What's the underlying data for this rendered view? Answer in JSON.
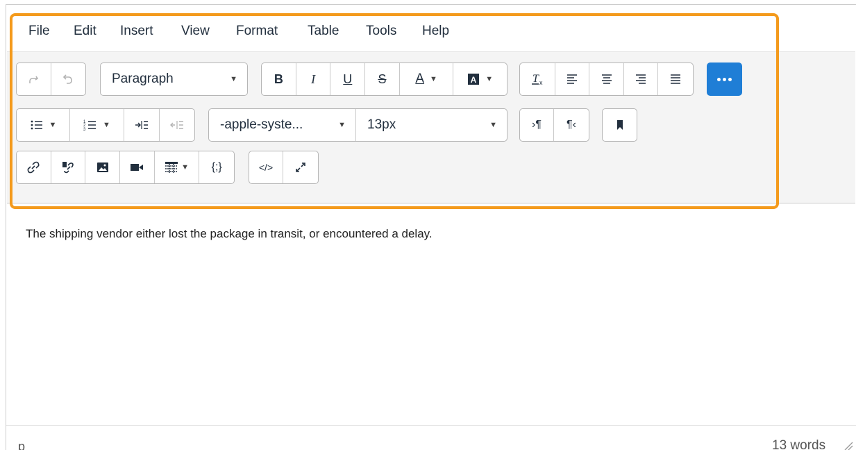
{
  "menubar": {
    "items": [
      "File",
      "Edit",
      "Insert",
      "View",
      "Format",
      "Table",
      "Tools",
      "Help"
    ]
  },
  "toolbar": {
    "block_format": "Paragraph",
    "font_family": "-apple-syste...",
    "font_size": "13px",
    "more_button_color": "#1f7ed6"
  },
  "content": {
    "paragraph": "The shipping vendor either lost the package in transit, or encountered a delay."
  },
  "statusbar": {
    "element_path": "p",
    "word_count": "13 words"
  },
  "colors": {
    "focus_ring": "#f49a1c",
    "toolbar_bg": "#f4f4f4"
  }
}
